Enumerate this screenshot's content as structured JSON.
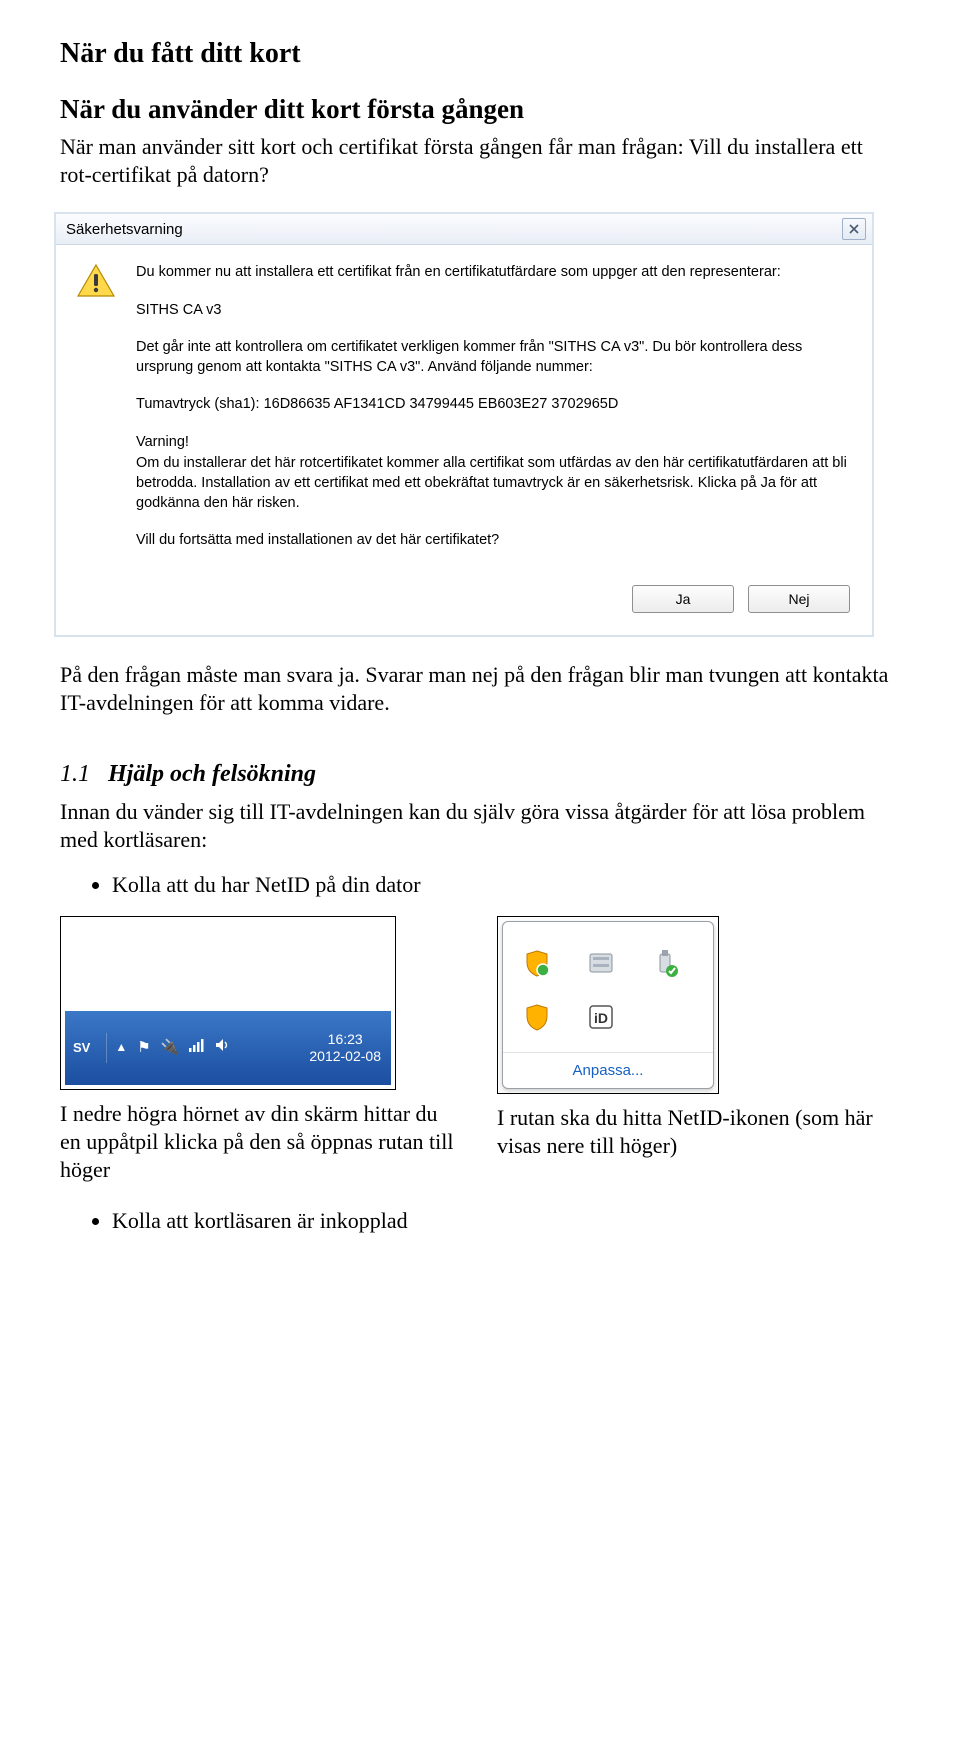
{
  "h1": "När du fått ditt kort",
  "h2": "När du använder ditt kort första gången",
  "intro": "När man använder sitt kort och certifikat första gången får man frågan: Vill du installera ett rot-certifikat på datorn?",
  "dialog": {
    "title": "Säkerhetsvarning",
    "p1": "Du kommer nu att installera ett certifikat från en certifikatutfärdare som uppger att den representerar:",
    "issuer": "SITHS CA v3",
    "p2": "Det går inte att kontrollera om certifikatet verkligen kommer från \"SITHS CA v3\". Du bör kontrollera dess ursprung genom att kontakta \"SITHS CA v3\". Använd följande nummer:",
    "thumb": "Tumavtryck (sha1): 16D86635 AF1341CD 34799445 EB603E27 3702965D",
    "warnlabel": "Varning!",
    "warn": "Om du installerar det här rotcertifikatet kommer alla certifikat som utfärdas av den här certifikatutfärdaren att bli betrodda. Installation av ett certifikat med ett obekräftat tumavtryck är en säkerhetsrisk. Klicka på Ja för att godkänna den här risken.",
    "q": "Vill du fortsätta med installationen av det här certifikatet?",
    "yes": "Ja",
    "no": "Nej"
  },
  "afterdlg": "På den frågan måste man svara ja. Svarar man nej på den frågan blir man tvungen att kontakta IT-avdelningen för att komma vidare.",
  "help": {
    "num": "1.1",
    "heading": "Hjälp och felsökning",
    "intro": "Innan du vänder sig till IT-avdelningen kan du själv göra vissa åtgärder för att lösa problem med kortläsaren:",
    "b1": "Kolla att du har NetID på din dator",
    "b2": "Kolla att kortläsaren är inkopplad"
  },
  "taskbar": {
    "lang": "SV",
    "time": "16:23",
    "date": "2012-02-08"
  },
  "tray": {
    "customize": "Anpassa..."
  },
  "caption_left": "I nedre högra hörnet av din skärm hittar du en uppåtpil klicka på den så öppnas rutan till höger",
  "caption_right": "I rutan ska du hitta NetID-ikonen (som här visas nere till höger)"
}
